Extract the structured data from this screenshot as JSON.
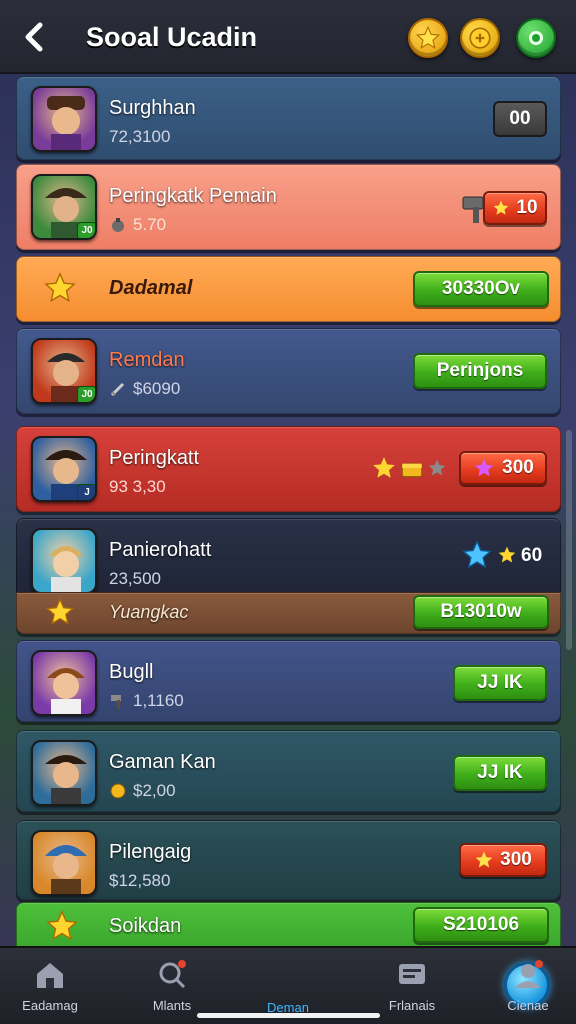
{
  "header": {
    "title": "Sooal Ucadin",
    "icons": [
      "star-icon",
      "coin-icon",
      "leaf-icon"
    ]
  },
  "rows": [
    {
      "name": "Surghhan",
      "sub": "72,3100",
      "action": "00",
      "action_kind": "dark",
      "bg": "#35557a"
    },
    {
      "name": "Peringkatk Pemain",
      "sub": "5.70",
      "action": "10",
      "action_kind": "red",
      "bg": "#f4907a"
    },
    {
      "name": "Dadamal",
      "action": "30330Ov",
      "action_kind": "green",
      "bg": "#f59a46"
    },
    {
      "name": "Remdan",
      "sub": "$6090",
      "action": "Perinjons",
      "action_kind": "green",
      "bg": "#3c5080"
    },
    {
      "name": "Peringkatt",
      "sub": "93 3,30",
      "action": "300",
      "action_kind": "red",
      "bg": "#c7352c"
    },
    {
      "name": "Panierohatt",
      "sub": "23,500",
      "action": "60",
      "action_kind": "text",
      "bg": "#232a3d"
    },
    {
      "name": "Yuangkac",
      "action": "B13010w",
      "action_kind": "green",
      "bg": "#7d5136"
    },
    {
      "name": "Bugll",
      "sub": "1,1160",
      "action": "JJ IK",
      "action_kind": "green",
      "bg": "#3c4c78"
    },
    {
      "name": "Gaman Kan",
      "sub": "$2,00",
      "action": "JJ IK",
      "action_kind": "green",
      "bg": "#2c4e5a"
    },
    {
      "name": "Pilengaig",
      "sub": "$12,580",
      "action": "300",
      "action_kind": "red",
      "bg": "#284a50"
    },
    {
      "name": "Soikdan",
      "action": "S210106",
      "action_kind": "green",
      "bg": "#3aa632"
    }
  ],
  "nav": [
    {
      "label": "Eadamag",
      "icon": "home-icon"
    },
    {
      "label": "Mlants",
      "icon": "search-icon"
    },
    {
      "label": "Deman",
      "icon": "target-icon"
    },
    {
      "label": "Frlanais",
      "icon": "chat-icon"
    },
    {
      "label": "Cienae",
      "icon": "profile-icon"
    }
  ],
  "colors": {
    "accent": "#3fb8ff",
    "green_button": "#3fae1a",
    "red_button": "#e33a1e"
  }
}
